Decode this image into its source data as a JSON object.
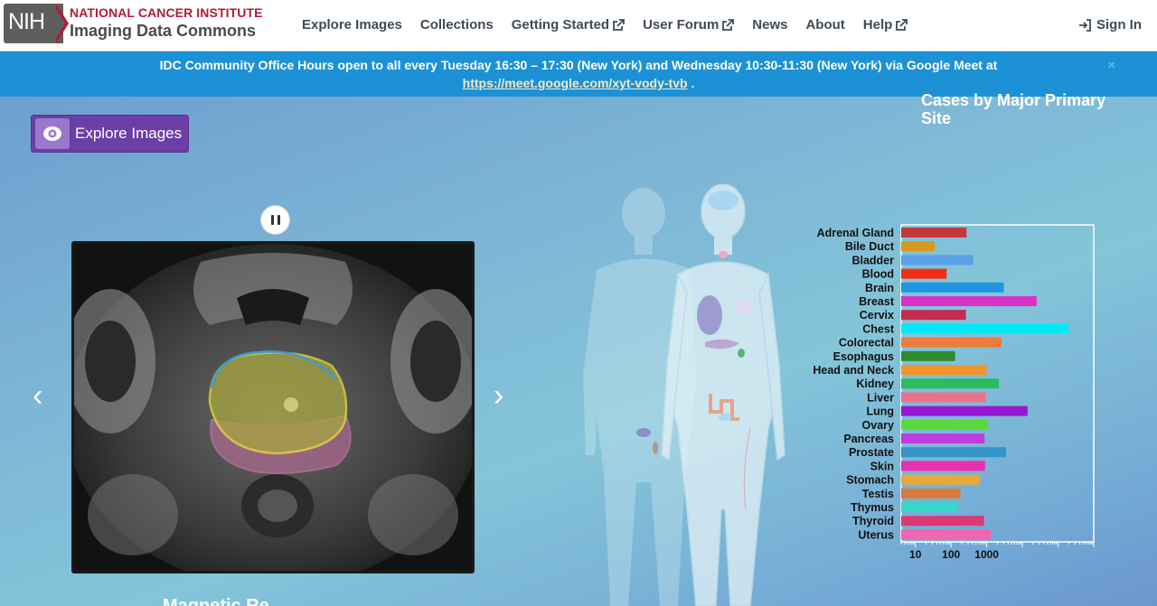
{
  "header": {
    "logo_mark": "NIH",
    "logo_org": "NATIONAL CANCER INSTITUTE",
    "logo_product": "Imaging Data Commons",
    "nav": [
      {
        "label": "Explore Images",
        "external": false
      },
      {
        "label": "Collections",
        "external": false
      },
      {
        "label": "Getting Started",
        "external": true
      },
      {
        "label": "User Forum",
        "external": true
      },
      {
        "label": "News",
        "external": false
      },
      {
        "label": "About",
        "external": false
      },
      {
        "label": "Help",
        "external": true
      }
    ],
    "signin_label": "Sign In",
    "signin_icon": "sign-in-icon"
  },
  "banner": {
    "text": "IDC Community Office Hours open to all every Tuesday 16:30 – 17:30 (New York) and Wednesday 10:30-11:30 (New York) via Google Meet at",
    "link": "https://meet.google.com/xyt-vody-tvb",
    "link_suffix": " .",
    "close": "×"
  },
  "hero": {
    "explore_button": "Explore Images",
    "explore_icon": "eye-icon",
    "prev_arrow": "‹",
    "next_arrow": "›",
    "caption": "Magnetic Re"
  },
  "colors": {
    "nih_red": "#b01c37",
    "banner_blue": "#1c91d6",
    "button_purple": "#6b3fa6"
  },
  "chart_data": {
    "type": "bar",
    "orientation": "horizontal",
    "title": "Cases by Major Primary Site",
    "x_scale": "log",
    "xlim": [
      4,
      1000000
    ],
    "x_tick_labels": [
      "10",
      "100",
      "1000"
    ],
    "categories": [
      "Adrenal Gland",
      "Bile Duct",
      "Bladder",
      "Blood",
      "Brain",
      "Breast",
      "Cervix",
      "Chest",
      "Colorectal",
      "Esophagus",
      "Head and Neck",
      "Kidney",
      "Liver",
      "Lung",
      "Ovary",
      "Pancreas",
      "Prostate",
      "Skin",
      "Stomach",
      "Testis",
      "Thymus",
      "Thyroid",
      "Uterus"
    ],
    "values": [
      270,
      35,
      420,
      75,
      3000,
      25000,
      260,
      200000,
      2600,
      130,
      1000,
      2200,
      950,
      14000,
      1050,
      870,
      3500,
      900,
      650,
      185,
      155,
      840,
      1300
    ],
    "colors": [
      "#c6373b",
      "#d69a1e",
      "#5aa0e8",
      "#f42d14",
      "#1f96e0",
      "#d832c6",
      "#c42b52",
      "#00e9f7",
      "#ef7b3b",
      "#2f8a2f",
      "#f29528",
      "#2abc5e",
      "#e8748c",
      "#9617d2",
      "#5ad83c",
      "#c23bdc",
      "#3294c8",
      "#ea2fb0",
      "#e8a93a",
      "#dc7b3c",
      "#38d6c6",
      "#dc3a77",
      "#f066b0"
    ]
  }
}
